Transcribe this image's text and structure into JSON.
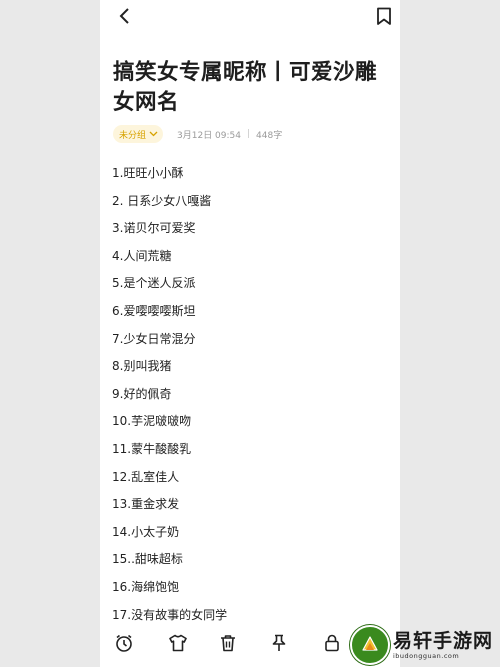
{
  "header": {
    "back_icon": "chevron-left-icon",
    "bookmark_icon": "bookmark-icon"
  },
  "note": {
    "title": "搞笑女专属昵称丨可爱沙雕女网名",
    "group_label": "未分组",
    "date": "3月12日 09:54",
    "separator": "|",
    "word_count": "448字"
  },
  "items": [
    "1.旺旺小小酥",
    "2. 日系少女八嘎酱",
    "3.诺贝尔可爱奖",
    "4.人间荒糖",
    "5.是个迷人反派",
    "6.爱嘤嘤嘤斯坦",
    "7.少女日常混分",
    "8.别叫我猪",
    "9.好的佩奇",
    "10.芋泥啵啵吻",
    "11.蒙牛酸酸乳",
    "12.乱室佳人",
    "13.重金求发",
    "14.小太子奶",
    "15..甜味超标",
    "16.海绵饱饱",
    "17.没有故事的女同学"
  ],
  "toolbar": {
    "icons": [
      "alarm-clock-icon",
      "tshirt-icon",
      "trash-icon",
      "pin-icon",
      "lock-icon"
    ]
  },
  "watermark": {
    "name": "易轩手游网",
    "url": "ibudongguan.com"
  },
  "colors": {
    "accent": "#d7a200",
    "accent_bg": "#fdf5dc",
    "meta_text": "#9a9a9a",
    "watermark_green": "#3a8a1e"
  }
}
